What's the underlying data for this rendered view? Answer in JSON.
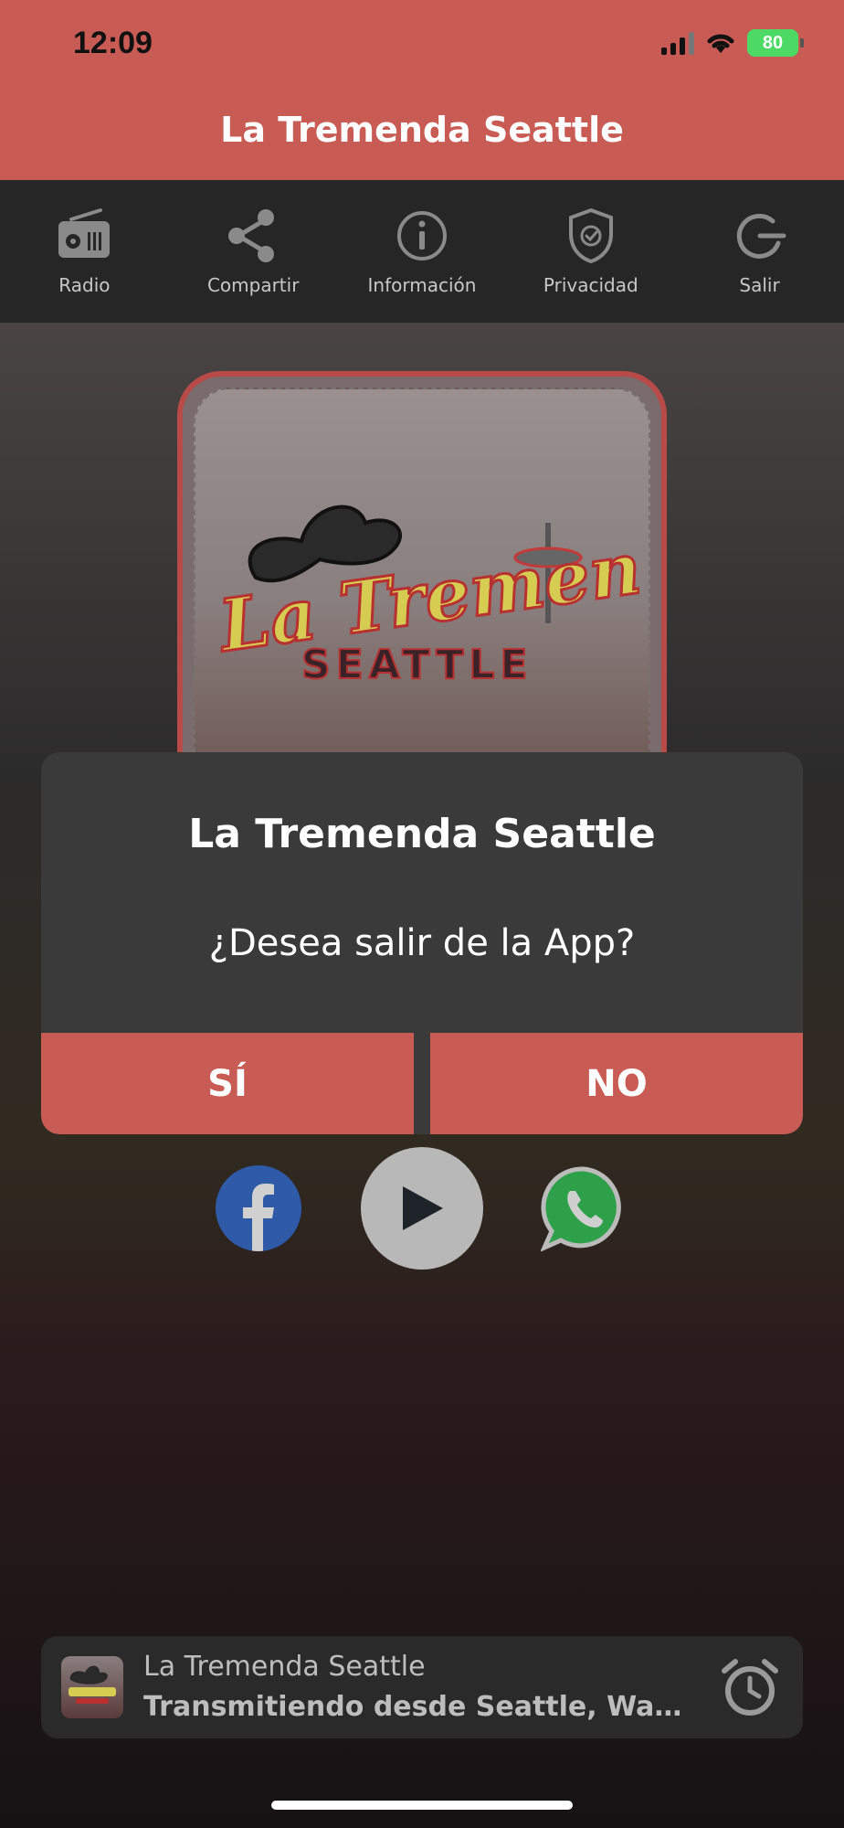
{
  "status_bar": {
    "time": "12:09",
    "battery": "80"
  },
  "header": {
    "title": "La Tremenda Seattle"
  },
  "nav": [
    {
      "label": "Radio",
      "icon": "radio-icon"
    },
    {
      "label": "Compartir",
      "icon": "share-icon"
    },
    {
      "label": "Información",
      "icon": "info-icon"
    },
    {
      "label": "Privacidad",
      "icon": "shield-check-icon"
    },
    {
      "label": "Salir",
      "icon": "power-icon"
    }
  ],
  "cover": {
    "logo_text": "La Tremenda SEATTLE",
    "logo_line1": "La Tremenda",
    "logo_line2": "SEATTLE"
  },
  "dialog": {
    "title": "La Tremenda Seattle",
    "message": "¿Desea salir de la App?",
    "yes_label": "SÍ",
    "no_label": "NO"
  },
  "controls": {
    "facebook_icon": "facebook-icon",
    "play_icon": "play-icon",
    "whatsapp_icon": "whatsapp-icon"
  },
  "mini_player": {
    "station": "La Tremenda Seattle",
    "subtitle": "Transmitiendo desde Seattle, Washi..."
  },
  "colors": {
    "accent": "#c85b53",
    "toolbar": "#262626",
    "dialog": "#3a3a3a",
    "facebook": "#2e5aa8",
    "whatsapp": "#2fa04a"
  }
}
